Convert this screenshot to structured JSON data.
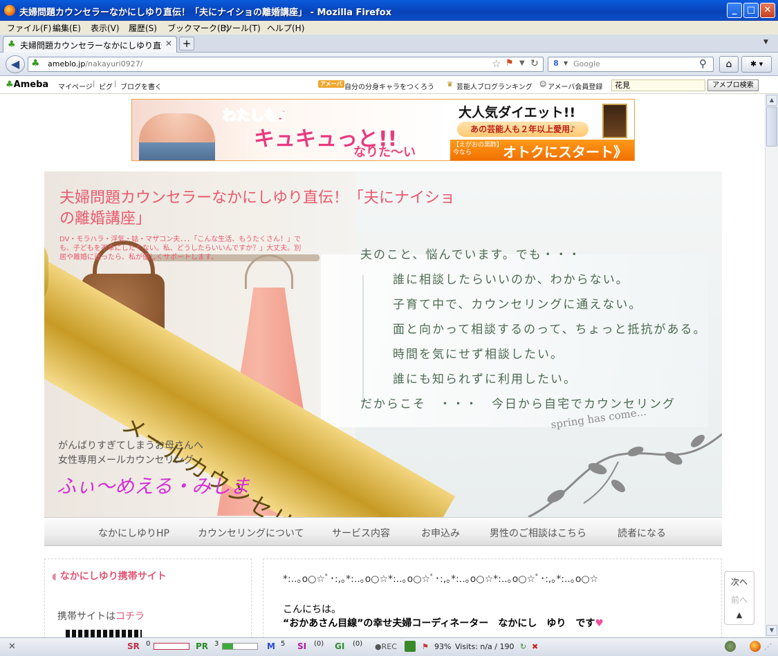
{
  "window": {
    "title": "夫婦問題カウンセラーなかにしゆり直伝！「夫にナイショの離婚講座」 - Mozilla Firefox",
    "minimize": "_",
    "maximize": "□",
    "close": "✕"
  },
  "menubar": [
    "ファイル(F)",
    "編集(E)",
    "表示(V)",
    "履歴(S)",
    "ブックマーク(B)",
    "ツール(T)",
    "ヘルプ(H)"
  ],
  "tab": {
    "label": "夫婦問題カウンセラーなかにしゆり直伝！「夫...",
    "close": "✕",
    "new_tab": "+"
  },
  "navbar": {
    "url_host": "ameblo.jp",
    "url_path": "/nakayuri0927/",
    "search_placeholder": "Google"
  },
  "ameba": {
    "logo": "Ameba",
    "links": [
      "マイページ",
      "ピグ",
      "ブログを書く"
    ],
    "badge": "アメーバ",
    "promo": "自分の分身キャラをつくろう",
    "ranking": "芸能人ブログランキング",
    "register": "アメーバ会員登録",
    "search_value": "花見",
    "search_button": "アメブロ検索"
  },
  "ad": {
    "line1": "わたしも♪",
    "line2": "キュキュっと!!",
    "line3": "なりた〜い",
    "right_title": "大人気ダイエット!!",
    "right_sub": "あの芸能人も２年以上愛用♪",
    "small1": "【えがおの黒酢】",
    "small2": "今なら",
    "cta": "オトクにスタート》"
  },
  "blog": {
    "title": "夫婦問題カウンセラーなかにしゆり直伝！「夫にナイショの離婚講座」",
    "description": "DV・モラハラ・浮気・姑・マザコン夫．．．「こんな生活、もうたくさん！」でも、子どもを不幸にしたくない。私、どうしたらいいんですか？」大丈夫。別居や離婚に迷ったら、私が優しくサポートします。",
    "copy": [
      "夫のこと、悩んでいます。でも・・・",
      "誰に相談したらいいのか、わからない。",
      "子育て中で、カウンセリングに通えない。",
      "面と向かって相談するのって、ちょっと抵抗がある。",
      "時間を気にせず相談したい。",
      "誰にも知られずに利用したい。",
      "だからこそ　・・・　今日から自宅でカウンセリング"
    ],
    "ribbon": "メールカウンセリング",
    "spring": "spring has come...",
    "sub1": "がんばりすぎてしまうお母さんへ",
    "sub2": "女性専用メールカウンセリング",
    "brand": "ふぃ〜めえる・みしま"
  },
  "nav_menu": [
    "なかにしゆりHP",
    "カウンセリングについて",
    "サービス内容",
    "お申込み",
    "男性のご相談はこちら",
    "読者になる"
  ],
  "sidebar": {
    "heading": "なかにしゆり携帯サイト",
    "text": "携帯サイトは",
    "link": "コチラ"
  },
  "main": {
    "deco": "*:..｡o○☆ﾟ･:,｡*:..｡o○☆*:..｡o○☆ﾟ･:,｡*:..｡o○☆*:..｡o○☆ﾟ･:,｡*:..｡o○☆",
    "p1": "こんにちは。",
    "p2": "“おかあさん目線”の幸せ夫婦コーディネーター　なかにし　ゆり　です"
  },
  "floatnav": {
    "next": "次へ",
    "prev": "前へ",
    "top": "▲"
  },
  "status": {
    "sr_label": "SR",
    "sr_value": "0",
    "pr_label": "PR",
    "pr_value": "3",
    "pr_level": 0.3,
    "m_label": "M",
    "m_value": "5",
    "si_label": "SI",
    "si_value": "(0)",
    "gi_label": "GI",
    "gi_value": "(0)",
    "rec": "●REC",
    "zoom": "93%",
    "visits": "Visits: n/a / 190"
  }
}
